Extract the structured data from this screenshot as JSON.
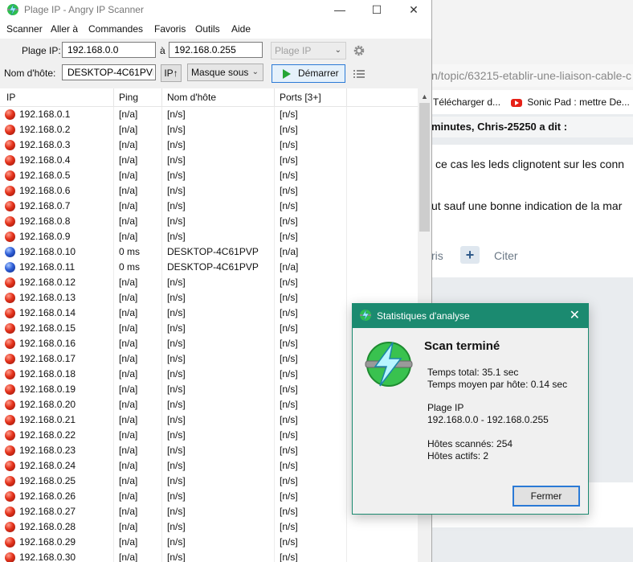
{
  "window": {
    "title": "Plage IP - Angry IP Scanner",
    "min": "—",
    "max": "☐",
    "close": "✕"
  },
  "menu": [
    "Scanner",
    "Aller à",
    "Commandes",
    "Favoris",
    "Outils",
    "Aide"
  ],
  "toolbar": {
    "range_label": "Plage IP:",
    "start_ip": "192.168.0.0",
    "to_label": "à",
    "end_ip": "192.168.0.255",
    "feeder_select": "Plage IP",
    "hostname_label": "Nom d'hôte:",
    "hostname": "DESKTOP-4C61PVP",
    "ip_button": "IP↑",
    "mask_select": "Masque sous",
    "start_button": "Démarrer"
  },
  "table": {
    "columns": [
      "IP",
      "Ping",
      "Nom d'hôte",
      "Ports [3+]"
    ],
    "rows": [
      {
        "ip": "192.168.0.1",
        "ping": "[n/a]",
        "host": "[n/s]",
        "ports": "[n/s]",
        "status": "dead"
      },
      {
        "ip": "192.168.0.2",
        "ping": "[n/a]",
        "host": "[n/s]",
        "ports": "[n/s]",
        "status": "dead"
      },
      {
        "ip": "192.168.0.3",
        "ping": "[n/a]",
        "host": "[n/s]",
        "ports": "[n/s]",
        "status": "dead"
      },
      {
        "ip": "192.168.0.4",
        "ping": "[n/a]",
        "host": "[n/s]",
        "ports": "[n/s]",
        "status": "dead"
      },
      {
        "ip": "192.168.0.5",
        "ping": "[n/a]",
        "host": "[n/s]",
        "ports": "[n/s]",
        "status": "dead"
      },
      {
        "ip": "192.168.0.6",
        "ping": "[n/a]",
        "host": "[n/s]",
        "ports": "[n/s]",
        "status": "dead"
      },
      {
        "ip": "192.168.0.7",
        "ping": "[n/a]",
        "host": "[n/s]",
        "ports": "[n/s]",
        "status": "dead"
      },
      {
        "ip": "192.168.0.8",
        "ping": "[n/a]",
        "host": "[n/s]",
        "ports": "[n/s]",
        "status": "dead"
      },
      {
        "ip": "192.168.0.9",
        "ping": "[n/a]",
        "host": "[n/s]",
        "ports": "[n/s]",
        "status": "dead"
      },
      {
        "ip": "192.168.0.10",
        "ping": "0 ms",
        "host": "DESKTOP-4C61PVP",
        "ports": "[n/a]",
        "status": "alive"
      },
      {
        "ip": "192.168.0.11",
        "ping": "0 ms",
        "host": "DESKTOP-4C61PVP",
        "ports": "[n/a]",
        "status": "alive"
      },
      {
        "ip": "192.168.0.12",
        "ping": "[n/a]",
        "host": "[n/s]",
        "ports": "[n/s]",
        "status": "dead"
      },
      {
        "ip": "192.168.0.13",
        "ping": "[n/a]",
        "host": "[n/s]",
        "ports": "[n/s]",
        "status": "dead"
      },
      {
        "ip": "192.168.0.14",
        "ping": "[n/a]",
        "host": "[n/s]",
        "ports": "[n/s]",
        "status": "dead"
      },
      {
        "ip": "192.168.0.15",
        "ping": "[n/a]",
        "host": "[n/s]",
        "ports": "[n/s]",
        "status": "dead"
      },
      {
        "ip": "192.168.0.16",
        "ping": "[n/a]",
        "host": "[n/s]",
        "ports": "[n/s]",
        "status": "dead"
      },
      {
        "ip": "192.168.0.17",
        "ping": "[n/a]",
        "host": "[n/s]",
        "ports": "[n/s]",
        "status": "dead"
      },
      {
        "ip": "192.168.0.18",
        "ping": "[n/a]",
        "host": "[n/s]",
        "ports": "[n/s]",
        "status": "dead"
      },
      {
        "ip": "192.168.0.19",
        "ping": "[n/a]",
        "host": "[n/s]",
        "ports": "[n/s]",
        "status": "dead"
      },
      {
        "ip": "192.168.0.20",
        "ping": "[n/a]",
        "host": "[n/s]",
        "ports": "[n/s]",
        "status": "dead"
      },
      {
        "ip": "192.168.0.21",
        "ping": "[n/a]",
        "host": "[n/s]",
        "ports": "[n/s]",
        "status": "dead"
      },
      {
        "ip": "192.168.0.22",
        "ping": "[n/a]",
        "host": "[n/s]",
        "ports": "[n/s]",
        "status": "dead"
      },
      {
        "ip": "192.168.0.23",
        "ping": "[n/a]",
        "host": "[n/s]",
        "ports": "[n/s]",
        "status": "dead"
      },
      {
        "ip": "192.168.0.24",
        "ping": "[n/a]",
        "host": "[n/s]",
        "ports": "[n/s]",
        "status": "dead"
      },
      {
        "ip": "192.168.0.25",
        "ping": "[n/a]",
        "host": "[n/s]",
        "ports": "[n/s]",
        "status": "dead"
      },
      {
        "ip": "192.168.0.26",
        "ping": "[n/a]",
        "host": "[n/s]",
        "ports": "[n/s]",
        "status": "dead"
      },
      {
        "ip": "192.168.0.27",
        "ping": "[n/a]",
        "host": "[n/s]",
        "ports": "[n/s]",
        "status": "dead"
      },
      {
        "ip": "192.168.0.28",
        "ping": "[n/a]",
        "host": "[n/s]",
        "ports": "[n/s]",
        "status": "dead"
      },
      {
        "ip": "192.168.0.29",
        "ping": "[n/a]",
        "host": "[n/s]",
        "ports": "[n/s]",
        "status": "dead"
      },
      {
        "ip": "192.168.0.30",
        "ping": "[n/a]",
        "host": "[n/s]",
        "ports": "[n/s]",
        "status": "dead"
      }
    ]
  },
  "dialog": {
    "title": "Statistiques d'analyse",
    "heading": "Scan terminé",
    "total_time": "Temps total: 35.1 sec",
    "avg_time": "Temps moyen par hôte: 0.14 sec",
    "range_label": "Plage IP",
    "range_value": "192.168.0.0 - 192.168.0.255",
    "hosts_scanned": "Hôtes scannés: 254",
    "hosts_alive": "Hôtes actifs: 2",
    "close_button": "Fermer"
  },
  "browser_bg": {
    "url": "n/topic/63215-etablir-une-liaison-cable-c",
    "bookmark1": "Télécharger d...",
    "bookmark2": "Sonic Pad : mettre De...",
    "quote_header": "minutes, Chris-25250 a dit :",
    "quote_line1": "ce cas les leds clignotent sur les conn",
    "quote_line2": "ut sauf une bonne indication de la mar",
    "action1": "ris",
    "action_plus": "+",
    "action2": "Citer"
  },
  "colors": {
    "dialog_accent": "#1b8a70",
    "alive_dot": "#2f5fd8",
    "dead_dot": "#e4321b"
  }
}
